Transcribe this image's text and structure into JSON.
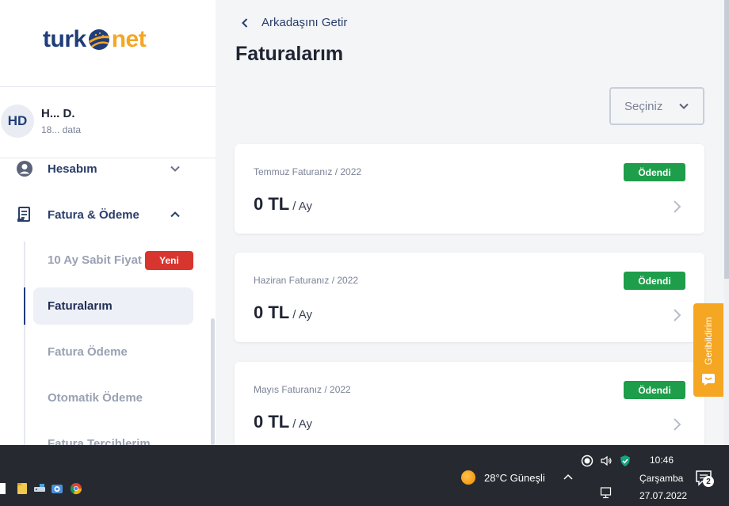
{
  "brand": {
    "logo_turk": "turk",
    "logo_net": "net",
    "primary": "#1f3d7a",
    "accent": "#f5a623"
  },
  "user": {
    "initials": "HD",
    "name": "H... D.",
    "subtitle": "18... data"
  },
  "sidebar": {
    "items": [
      {
        "label": "Hesabım",
        "icon": "user-circle-icon",
        "expanded": false
      },
      {
        "label": "Fatura & Ödeme",
        "icon": "invoice-icon",
        "expanded": true
      }
    ],
    "submenu": [
      {
        "label": "10 Ay Sabit Fiyat",
        "badge": "Yeni"
      },
      {
        "label": "Faturalarım",
        "active": true
      },
      {
        "label": "Fatura Ödeme"
      },
      {
        "label": "Otomatik Ödeme"
      },
      {
        "label": "Fatura Tercihlerim"
      }
    ]
  },
  "header": {
    "back_label": "Arkadaşını Getir",
    "title": "Faturalarım"
  },
  "filter": {
    "placeholder": "Seçiniz"
  },
  "invoices": [
    {
      "title": "Temmuz Faturanız / 2022",
      "amount": "0 TL",
      "period": "/ Ay",
      "status": "Ödendi"
    },
    {
      "title": "Haziran Faturanız / 2022",
      "amount": "0 TL",
      "period": "/ Ay",
      "status": "Ödendi"
    },
    {
      "title": "Mayıs Faturanız / 2022",
      "amount": "0 TL",
      "period": "/ Ay",
      "status": "Ödendi"
    }
  ],
  "feedback": {
    "label": "Geribildirim"
  },
  "taskbar": {
    "weather": "28°C  Güneşli",
    "time": "10:46",
    "day": "Çarşamba",
    "date": "27.07.2022",
    "notifications": "2"
  },
  "colors": {
    "paid": "#1e9d4a",
    "new_badge": "#d9352f"
  }
}
